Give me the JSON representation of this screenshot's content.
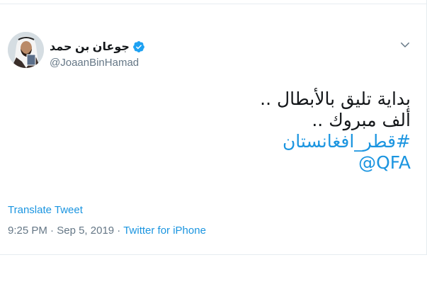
{
  "user": {
    "display_name": "جوعان بن حمد",
    "handle": "@JoaanBinHamad"
  },
  "tweet": {
    "line1": "بداية تليق بالأبطال ..",
    "line2": "ألف مبروك ..",
    "hashtag": "#قطر_افغانستان",
    "mention": "@QFA"
  },
  "actions": {
    "translate": "Translate Tweet"
  },
  "meta": {
    "time": "9:25 PM",
    "separator1": " · ",
    "date": "Sep 5, 2019",
    "separator2": " · ",
    "source": "Twitter for iPhone"
  },
  "colors": {
    "link": "#1b95e0",
    "secondary": "#657786",
    "verified": "#1da1f2"
  },
  "icons": {
    "verified": "verified-badge-icon",
    "menu": "chevron-down-icon"
  }
}
